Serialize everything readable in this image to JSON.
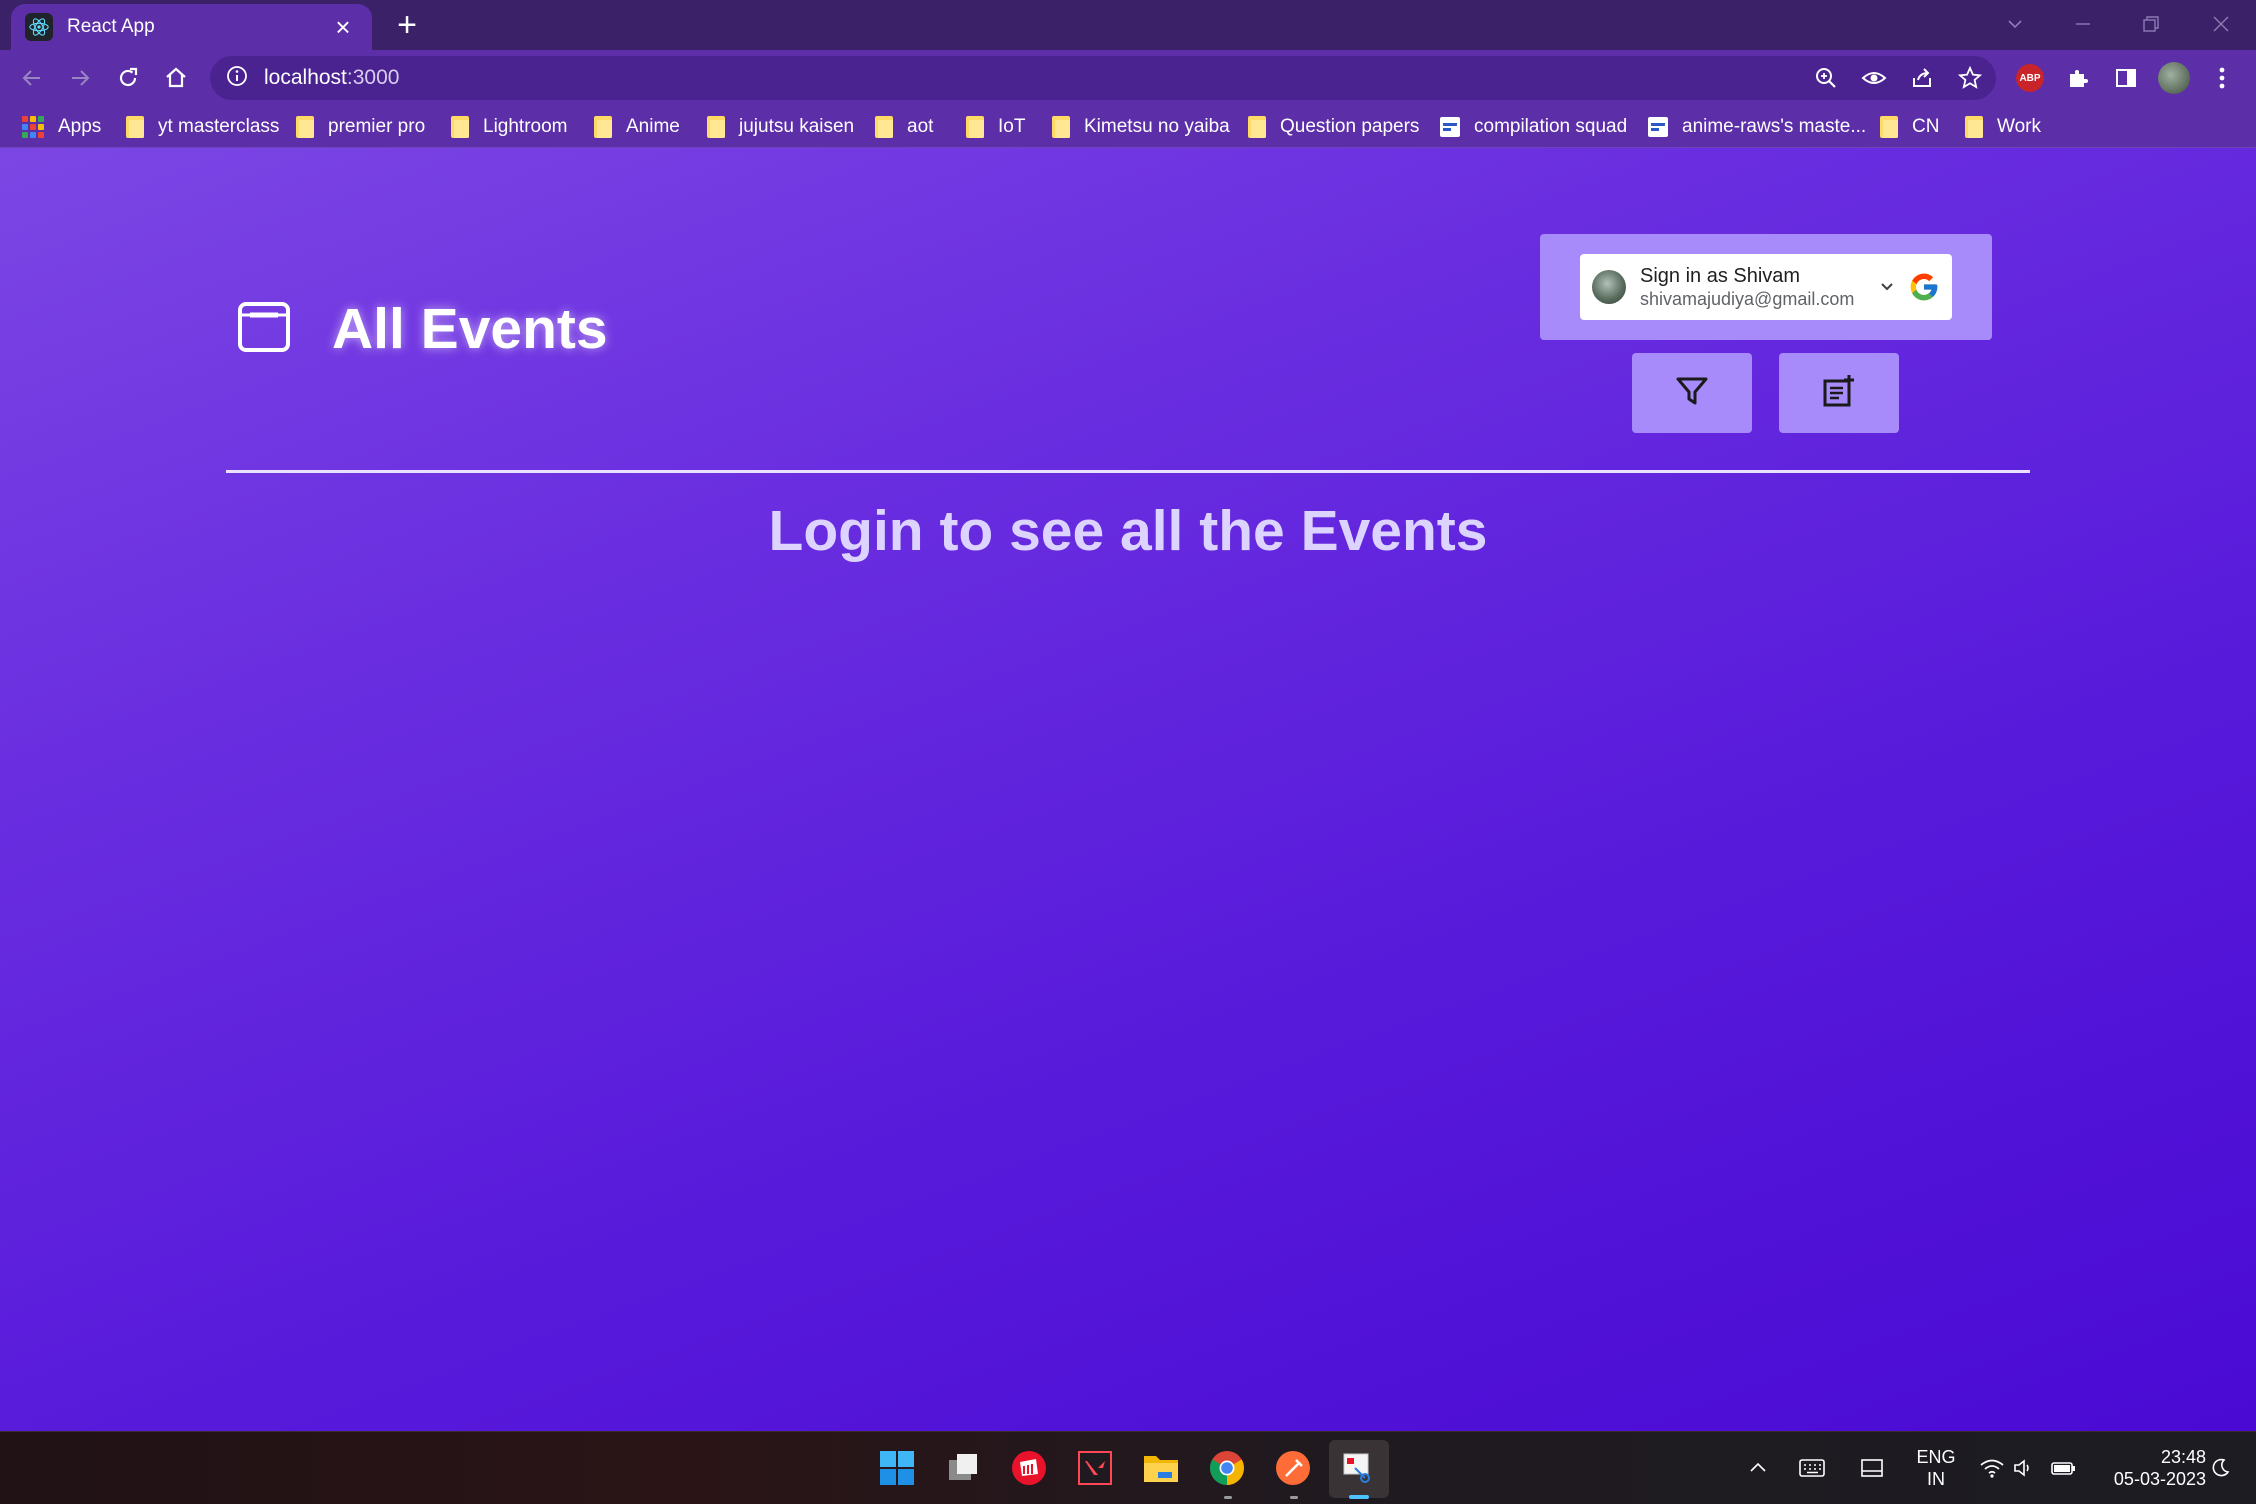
{
  "browser": {
    "tab_title": "React App",
    "url_host": "localhost",
    "url_port": ":3000",
    "bookmarks": [
      {
        "label": "Apps",
        "kind": "apps"
      },
      {
        "label": "yt masterclass",
        "kind": "folder"
      },
      {
        "label": "premier pro",
        "kind": "folder"
      },
      {
        "label": "Lightroom",
        "kind": "folder"
      },
      {
        "label": "Anime",
        "kind": "folder"
      },
      {
        "label": "jujutsu kaisen",
        "kind": "folder"
      },
      {
        "label": "aot",
        "kind": "folder"
      },
      {
        "label": "IoT",
        "kind": "folder"
      },
      {
        "label": "Kimetsu no yaiba",
        "kind": "folder"
      },
      {
        "label": "Question papers",
        "kind": "folder"
      },
      {
        "label": "compilation squad",
        "kind": "site"
      },
      {
        "label": "anime-raws's maste...",
        "kind": "site"
      },
      {
        "label": "CN",
        "kind": "folder"
      },
      {
        "label": "Work",
        "kind": "folder"
      }
    ],
    "extension_badge": "ABP"
  },
  "page": {
    "title": "All Events",
    "signin": {
      "name_line": "Sign in as Shivam",
      "email": "shivamajudiya@gmail.com"
    },
    "filter_icon": "filter-icon",
    "add_event_icon": "add-note-icon",
    "login_message": "Login to see all the Events"
  },
  "taskbar": {
    "language": "ENG",
    "region": "IN",
    "time": "23:48",
    "date": "05-03-2023"
  },
  "colors": {
    "page_gradient_start": "#7c46e4",
    "page_gradient_end": "#4a0ad4",
    "card_bg": "#a78bfa",
    "chrome_bg": "#5c2ea8"
  }
}
